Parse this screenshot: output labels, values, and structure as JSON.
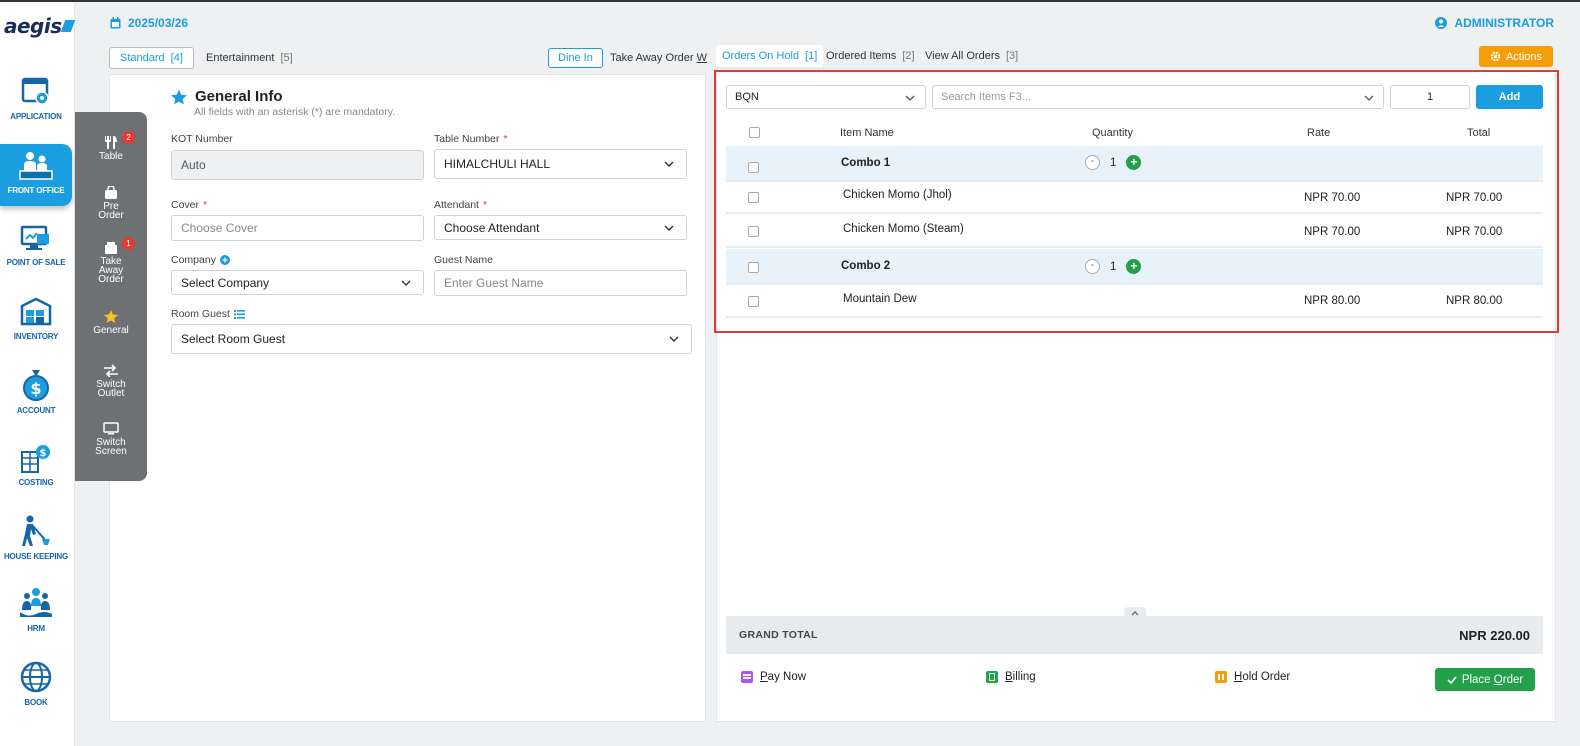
{
  "header": {
    "date": "2025/03/26",
    "user": "ADMINISTRATOR"
  },
  "app_nav": [
    {
      "label": "APPLICATION",
      "icon": "application-icon"
    },
    {
      "label": "FRONT OFFICE",
      "icon": "front-office-icon",
      "active": true
    },
    {
      "label": "POINT OF SALE",
      "icon": "point-of-sale-icon"
    },
    {
      "label": "INVENTORY",
      "icon": "inventory-icon"
    },
    {
      "label": "ACCOUNT",
      "icon": "account-icon"
    },
    {
      "label": "COSTING",
      "icon": "costing-icon"
    },
    {
      "label": "HOUSE KEEPING",
      "icon": "house-keeping-icon"
    },
    {
      "label": "HRM",
      "icon": "hrm-icon"
    },
    {
      "label": "BOOK",
      "icon": "book-icon"
    }
  ],
  "side_menu": {
    "table": {
      "label": "Table",
      "badge": "2"
    },
    "pre_order": {
      "label_1": "Pre",
      "label_2": "Order"
    },
    "take_away": {
      "label_1": "Take",
      "label_2": "Away",
      "label_3": "Order",
      "badge": "1"
    },
    "general": {
      "label": "General"
    },
    "switch_outlet": {
      "label_1": "Switch",
      "label_2": "Outlet"
    },
    "switch_screen": {
      "label_1": "Switch",
      "label_2": "Screen"
    }
  },
  "left_tabs": {
    "standard": {
      "label": "Standard",
      "count": "[4]"
    },
    "entertainment": {
      "label": "Entertainment",
      "count": "[5]"
    },
    "dine_in": "Dine In",
    "take_away": {
      "label": "Take Away Order ",
      "key": "W"
    }
  },
  "general_info": {
    "title": "General Info",
    "subtitle": "All fields with an asterisk (*) are mandatory.",
    "kot_label": "KOT Number",
    "kot_value": "Auto",
    "table_label": "Table Number",
    "table_value": "HIMALCHULI HALL",
    "cover_label": "Cover",
    "cover_placeholder": "Choose Cover",
    "attendant_label": "Attendant",
    "attendant_value": "Choose Attendant",
    "company_label": "Company",
    "company_value": "Select Company",
    "guest_label": "Guest Name",
    "guest_placeholder": "Enter Guest Name",
    "room_guest_label": "Room Guest",
    "room_guest_value": "Select Room Guest",
    "required_mark": "*"
  },
  "right_tabs": [
    {
      "label": "Orders On Hold",
      "count": "[1]",
      "active": true
    },
    {
      "label": "Ordered Items",
      "count": "[2]"
    },
    {
      "label": "View All Orders",
      "count": "[3]"
    }
  ],
  "actions_label": "Actions",
  "order_entry": {
    "outlet_value": "BQN",
    "search_placeholder": "Search Items F3...",
    "quantity_value": "1",
    "add_label": "Add"
  },
  "table": {
    "headers": {
      "name": "Item Name",
      "quantity": "Quantity",
      "rate": "Rate",
      "total": "Total"
    },
    "rows": [
      {
        "type": "combo",
        "name": "Combo 1",
        "qty": "1"
      },
      {
        "type": "item",
        "name": "Chicken Momo (Jhol)",
        "rate": "NPR 70.00",
        "total": "NPR 70.00"
      },
      {
        "type": "item",
        "name": "Chicken Momo (Steam)",
        "rate": "NPR 70.00",
        "total": "NPR 70.00"
      },
      {
        "type": "combo",
        "name": "Combo 2",
        "qty": "1"
      },
      {
        "type": "item",
        "name": "Mountain Dew",
        "rate": "NPR 80.00",
        "total": "NPR 80.00"
      }
    ]
  },
  "grand_total": {
    "label": "GRAND TOTAL",
    "value": "NPR 220.00"
  },
  "footer": {
    "pay_now": {
      "key": "P",
      "rest": "ay Now"
    },
    "billing": {
      "key": "B",
      "rest": "illing"
    },
    "hold_order": {
      "key": "H",
      "rest": "old Order"
    },
    "place_order": {
      "prefix": "Place ",
      "key": "O",
      "rest": "rder"
    }
  },
  "colors": {
    "accent": "#1a9ee0",
    "success": "#22a04a",
    "warning": "#f59e0b",
    "danger": "#e53935"
  }
}
